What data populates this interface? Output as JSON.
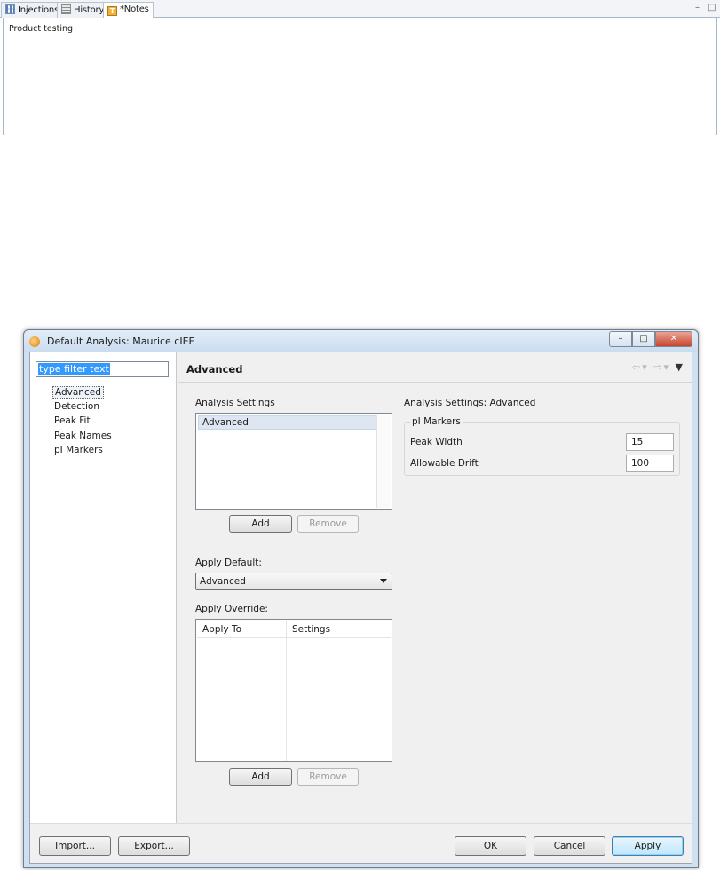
{
  "notes_panel": {
    "tabs": [
      {
        "label": "Injections",
        "icon": "grid-icon"
      },
      {
        "label": "History",
        "icon": "history-icon"
      },
      {
        "label": "*Notes",
        "icon": "notes-icon"
      }
    ],
    "notes_text": "Product testing"
  },
  "dialog": {
    "title": "Default Analysis: Maurice cIEF",
    "filter_placeholder": "type filter text",
    "nav_items": [
      "Advanced",
      "Detection",
      "Peak Fit",
      "Peak Names",
      "pI Markers"
    ],
    "selected_nav": "Advanced",
    "page_title": "Advanced",
    "analysis_settings_label": "Analysis Settings",
    "analysis_settings_items": [
      "Advanced"
    ],
    "add_label": "Add",
    "remove_label": "Remove",
    "apply_default_label": "Apply Default:",
    "apply_default_value": "Advanced",
    "apply_override_label": "Apply Override:",
    "override_columns": [
      "Apply To",
      "Settings"
    ],
    "settings_header": "Analysis Settings: Advanced",
    "pi_markers_group": "pI Markers",
    "peak_width_label": "Peak Width",
    "peak_width_value": "15",
    "allowable_drift_label": "Allowable Drift",
    "allowable_drift_value": "100",
    "buttons": {
      "import": "Import...",
      "export": "Export...",
      "ok": "OK",
      "cancel": "Cancel",
      "apply": "Apply"
    }
  }
}
